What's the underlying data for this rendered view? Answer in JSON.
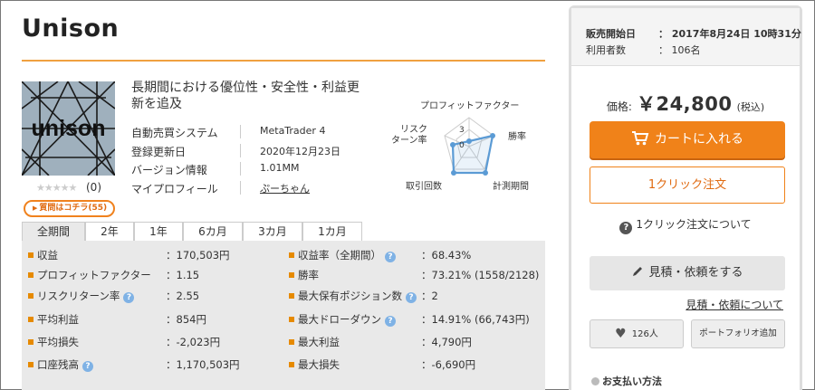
{
  "product": {
    "title": "Unison",
    "thumb_text": "unison",
    "description": "長期間における優位性・安全性・利益更新を追及",
    "rating_stars": "★★★★★",
    "rating_count": "(0)",
    "question_link": "質問はコチラ(55)"
  },
  "info": [
    {
      "label": "自動売買システム",
      "value": "MetaTrader 4"
    },
    {
      "label": "登録更新日",
      "value": "2020年12月23日"
    },
    {
      "label": "バージョン情報",
      "value": "1.01MM"
    },
    {
      "label": "マイプロフィール",
      "value": "ぷーちゃん"
    }
  ],
  "radar": {
    "labels": {
      "pf": "プロフィットファクター",
      "win": "勝率",
      "period": "計測期間",
      "trades": "取引回数",
      "risk_1": "リスク",
      "risk_2": "ターン率"
    },
    "scale_max": "3",
    "scale_zero": "0",
    "color": "#5b9bd5"
  },
  "tabs": [
    "全期間",
    "2年",
    "1年",
    "6カ月",
    "3カ月",
    "1カ月"
  ],
  "stats_left": [
    {
      "label": "収益",
      "value": "：170,503円",
      "help": false
    },
    {
      "label": "プロフィットファクター",
      "value": "：1.15",
      "help": false
    },
    {
      "label": "リスクリターン率",
      "value": "：2.55",
      "help": true
    },
    {
      "label": "平均利益",
      "value": "：854円",
      "help": false
    },
    {
      "label": "平均損失",
      "value": "：-2,023円",
      "help": false
    },
    {
      "label": "口座残高",
      "value": "：1,170,503円",
      "help": true
    }
  ],
  "stats_right": [
    {
      "label": "収益率（全期間）",
      "value": "：68.43%",
      "help": true
    },
    {
      "label": "勝率",
      "value": "：73.21% (1558/2128)",
      "help": false
    },
    {
      "label": "最大保有ポジション数",
      "value": "：2",
      "help": true
    },
    {
      "label": "最大ドローダウン",
      "value": "：14.91% (66,743円)",
      "help": true
    },
    {
      "label": "最大利益",
      "value": "：4,790円",
      "help": false
    },
    {
      "label": "最大損失",
      "value": "：-6,690円",
      "help": false
    }
  ],
  "help_glyph": "?",
  "sidebar": {
    "sale_start_label": "販売開始日",
    "sale_start_value": "：  2017年8月24日 10時31分",
    "users_label": "利用者数",
    "users_value": "：  106名",
    "price_label": "価格:",
    "price_value": "￥24,800",
    "price_tax": "(税込)",
    "cart_button": "カートに入れる",
    "oneclick_button": "1クリック注文",
    "about_oneclick": "1クリック注文について",
    "quote_button": "見積・依頼をする",
    "about_quote": "見積・依頼について",
    "favorites": "126人",
    "portfolio_button": "ポートフォリオ追加",
    "payment_heading": "お支払い方法"
  },
  "colors": {
    "accent": "#f08219",
    "stat_square": "#e68a00",
    "rule": "#f0a040"
  }
}
